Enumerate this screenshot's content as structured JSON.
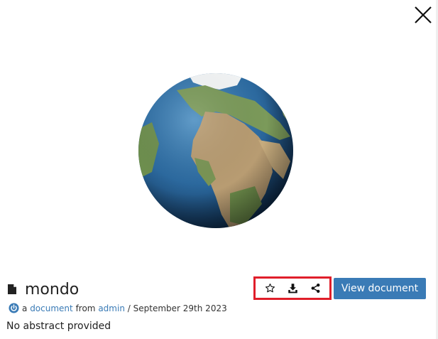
{
  "modal": {
    "close_icon": "close-icon"
  },
  "document": {
    "title": "mondo",
    "type_icon": "file-icon",
    "meta": {
      "prefix": "a",
      "type_link": "document",
      "from_text": "from",
      "author_link": "admin",
      "separator": "/",
      "date": "September 29th 2023"
    },
    "abstract": "No abstract provided"
  },
  "actions": {
    "favorite_icon": "star-icon",
    "download_icon": "download-icon",
    "share_icon": "share-icon",
    "view_label": "View document"
  },
  "colors": {
    "accent": "#3a7bb6",
    "highlight_border": "#e01e2a"
  }
}
